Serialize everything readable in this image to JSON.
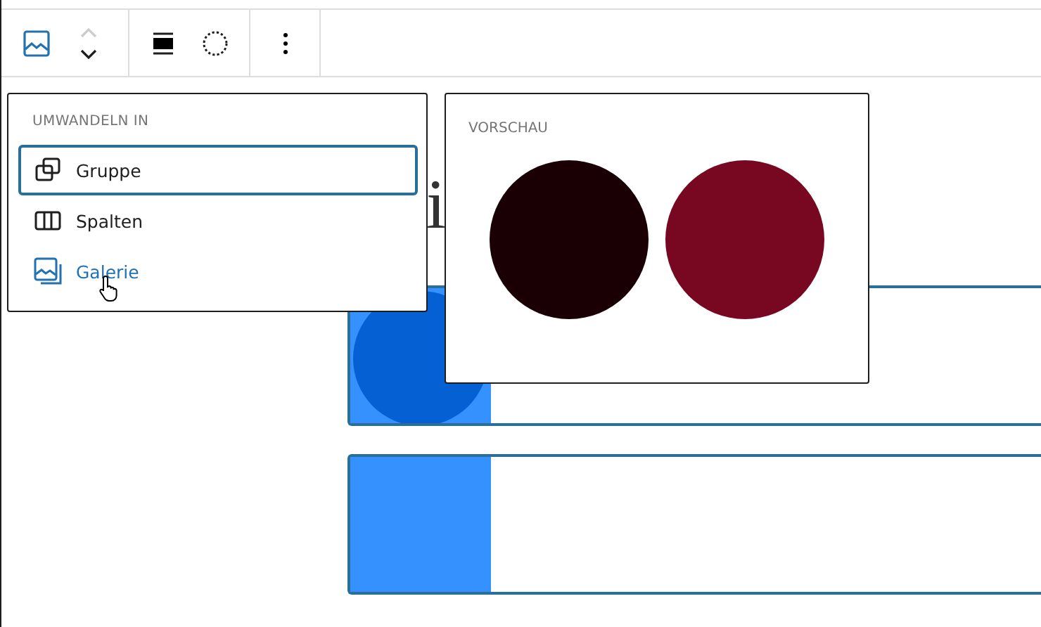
{
  "toolbar": {
    "block_icon": {
      "selected": true
    },
    "move_up": {
      "disabled": true
    },
    "move_down": {
      "disabled": false
    }
  },
  "heading_fragment": "i",
  "cards": [
    {
      "kind": "circle"
    },
    {
      "kind": "plain"
    }
  ],
  "transform_menu": {
    "heading": "UMWANDELN IN",
    "items": [
      {
        "kind": "group",
        "label": "Gruppe",
        "focused": true,
        "hovered": false
      },
      {
        "kind": "columns",
        "label": "Spalten",
        "focused": false,
        "hovered": false
      },
      {
        "kind": "gallery",
        "label": "Galerie",
        "focused": false,
        "hovered": true
      }
    ]
  },
  "preview": {
    "heading": "VORSCHAU",
    "swatches": [
      {
        "color": "#1a0005"
      },
      {
        "color": "#780722"
      }
    ]
  }
}
